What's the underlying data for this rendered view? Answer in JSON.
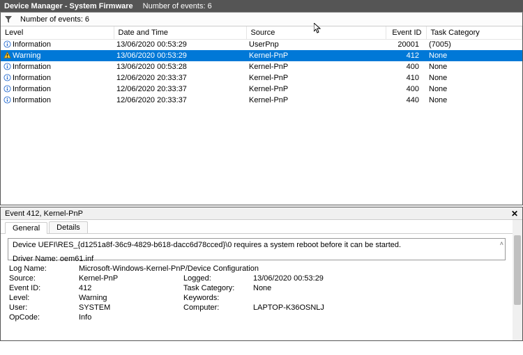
{
  "window": {
    "title": "Device Manager - System Firmware",
    "subtitle": "Number of events: 6"
  },
  "toolbar": {
    "count_label": "Number of events: 6"
  },
  "columns": {
    "level": "Level",
    "date": "Date and Time",
    "source": "Source",
    "eventid": "Event ID",
    "category": "Task Category"
  },
  "rows": [
    {
      "icon": "info",
      "level": "Information",
      "date": "13/06/2020 00:53:29",
      "source": "UserPnp",
      "eventid": "20001",
      "category": "(7005)"
    },
    {
      "icon": "warn",
      "level": "Warning",
      "date": "13/06/2020 00:53:29",
      "source": "Kernel-PnP",
      "eventid": "412",
      "category": "None",
      "selected": true
    },
    {
      "icon": "info",
      "level": "Information",
      "date": "13/06/2020 00:53:28",
      "source": "Kernel-PnP",
      "eventid": "400",
      "category": "None"
    },
    {
      "icon": "info",
      "level": "Information",
      "date": "12/06/2020 20:33:37",
      "source": "Kernel-PnP",
      "eventid": "410",
      "category": "None"
    },
    {
      "icon": "info",
      "level": "Information",
      "date": "12/06/2020 20:33:37",
      "source": "Kernel-PnP",
      "eventid": "400",
      "category": "None"
    },
    {
      "icon": "info",
      "level": "Information",
      "date": "12/06/2020 20:33:37",
      "source": "Kernel-PnP",
      "eventid": "440",
      "category": "None"
    }
  ],
  "detail": {
    "header": "Event 412, Kernel-PnP",
    "tabs": {
      "general": "General",
      "details": "Details"
    },
    "message_line1": "Device UEFI\\RES_{d1251a8f-36c9-4829-b618-dacc6d78cced}\\0 requires a system reboot before it can be started.",
    "message_line2": "Driver Name: oem61.inf",
    "labels": {
      "logname": "Log Name:",
      "source": "Source:",
      "eventid": "Event ID:",
      "level": "Level:",
      "user": "User:",
      "opcode": "OpCode:",
      "logged": "Logged:",
      "category": "Task Category:",
      "keywords": "Keywords:",
      "computer": "Computer:"
    },
    "values": {
      "logname": "Microsoft-Windows-Kernel-PnP/Device Configuration",
      "source": "Kernel-PnP",
      "eventid": "412",
      "level": "Warning",
      "user": "SYSTEM",
      "opcode": "Info",
      "logged": "13/06/2020 00:53:29",
      "category": "None",
      "keywords": "",
      "computer": "LAPTOP-K36OSNLJ"
    }
  }
}
